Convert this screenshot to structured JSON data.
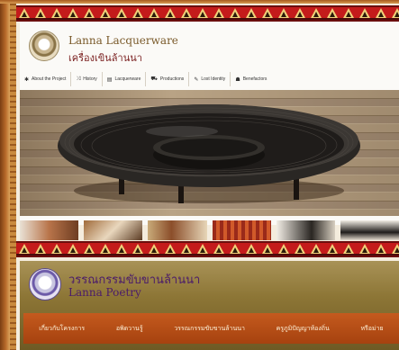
{
  "site1": {
    "title": "Lanna Lacquerware",
    "subtitle": "เครื่องเขินล้านนา",
    "nav": [
      {
        "label": "About the Project",
        "icon": "asterisk-icon",
        "glyph": "✱"
      },
      {
        "label": "History",
        "icon": "shuffle-icon",
        "glyph": "⤨"
      },
      {
        "label": "Lacquerware",
        "icon": "list-icon",
        "glyph": "▤"
      },
      {
        "label": "Productions",
        "icon": "cart-icon",
        "glyph": "⛟"
      },
      {
        "label": "Lost Identity",
        "icon": "pen-icon",
        "glyph": "✎"
      },
      {
        "label": "Benefactors",
        "icon": "users-icon",
        "glyph": "☗"
      }
    ]
  },
  "site2": {
    "title": "วรรณกรรมขับขานล้านนา",
    "subtitle": "Lanna Poetry",
    "nav": [
      {
        "label": "เกี่ยวกับโครงการ"
      },
      {
        "label": "อพิดวานรู้"
      },
      {
        "label": "วรรณกรรมขับขานล้านนา"
      },
      {
        "label": "ครูภูมิปัญญาท้องถิ่น"
      },
      {
        "label": "หรีอม่าย"
      }
    ]
  },
  "colors": {
    "band": "#c41b1b",
    "nav2_bg": "#b44c15",
    "site1_title": "#7a5a2a",
    "site2_title": "#4a1b6a"
  }
}
